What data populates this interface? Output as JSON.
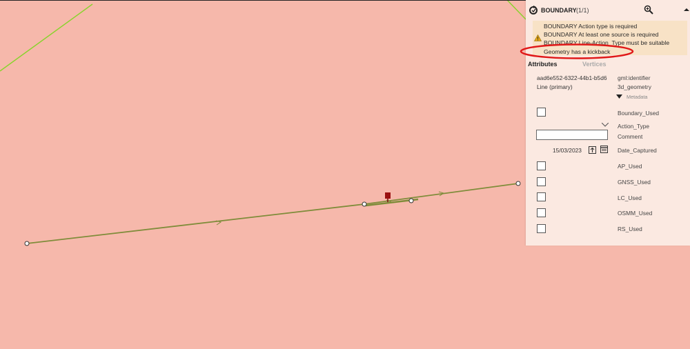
{
  "panel": {
    "title": "BOUNDARY",
    "count": "(1/1)",
    "warnings": [
      "BOUNDARY Action type is required",
      "BOUNDARY At least one source is required",
      "BOUNDARY Line-Action_Type must be suitable",
      "Geometry has a kickback"
    ],
    "tabs": {
      "attributes": "Attributes",
      "vertices": "Vertices"
    },
    "feature_id": "aad6e552-6322-44b1-b5d6",
    "feature_type": "Line (primary)",
    "labels": {
      "identifier": "gml:identifier",
      "geometry": "3d_geometry",
      "metadata": "Metadata",
      "boundary_used": "Boundary_Used",
      "action_type": "Action_Type",
      "comment": "Comment",
      "date_captured": "Date_Captured",
      "ap_used": "AP_Used",
      "gnss_used": "GNSS_Used",
      "lc_used": "LC_Used",
      "osmm_used": "OSMM_Used",
      "rs_used": "RS_Used"
    },
    "date_value": "15/03/2023"
  },
  "colors": {
    "map_background": "#f6b8ab",
    "line_feature": "#7f8c3a",
    "green_lines": "#7fd61f",
    "highlight_ellipse": "#e01818"
  }
}
